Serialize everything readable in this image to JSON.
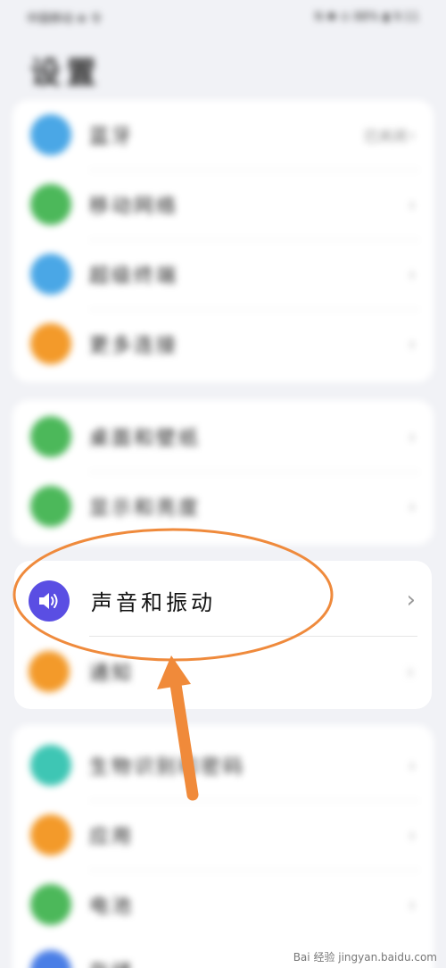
{
  "status_bar": {
    "left": "中国移动 ⊕ 令",
    "right": "N ✱ ⊙ 88% ▮ 9:11"
  },
  "page_title": "设置",
  "groups": [
    {
      "items": [
        {
          "label": "蓝牙",
          "value": "已关闭",
          "icon": "bluetooth-icon",
          "color": "#4aa7e6"
        },
        {
          "label": "移动网络",
          "icon": "mobile-network-icon",
          "color": "#4cb85a"
        },
        {
          "label": "超级终端",
          "icon": "super-device-icon",
          "color": "#4aa7e6"
        },
        {
          "label": "更多连接",
          "icon": "more-connections-icon",
          "color": "#f39a2a"
        }
      ]
    },
    {
      "items": [
        {
          "label": "桌面和壁纸",
          "icon": "wallpaper-icon",
          "color": "#4cb85a"
        },
        {
          "label": "显示和亮度",
          "icon": "display-icon",
          "color": "#4cb85a"
        }
      ]
    },
    {
      "items": [
        {
          "label": "声音和振动",
          "icon": "speaker-icon",
          "color": "#5a4ee3"
        },
        {
          "label": "通知",
          "icon": "notification-icon",
          "color": "#f39a2a"
        }
      ]
    },
    {
      "items": [
        {
          "label": "生物识别和密码",
          "icon": "biometric-icon",
          "color": "#3ec6b4"
        },
        {
          "label": "应用",
          "icon": "apps-icon",
          "color": "#f39a2a"
        },
        {
          "label": "电池",
          "icon": "battery-icon",
          "color": "#4cb85a"
        },
        {
          "label": "存储",
          "icon": "storage-icon",
          "color": "#4a7ee6"
        }
      ]
    }
  ],
  "annotation": {
    "ellipse_color": "#ef8a3c",
    "arrow_color": "#f08a3a"
  },
  "watermark": "Bai 经验 jingyan.baidu.com"
}
